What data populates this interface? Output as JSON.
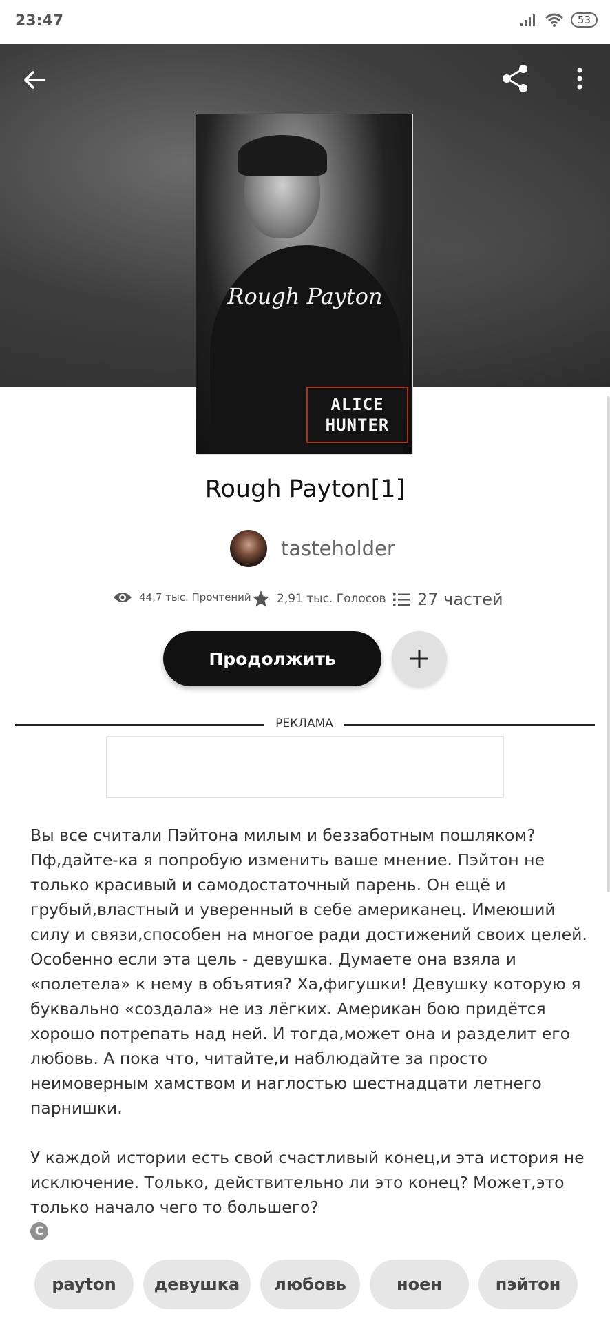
{
  "status_bar": {
    "time": "23:47",
    "battery": "53"
  },
  "toolbar": {
    "back": "back",
    "share": "share",
    "more": "more"
  },
  "cover": {
    "title": "Rough Payton",
    "stamp_line1": "ALICE",
    "stamp_line2": "HUNTER"
  },
  "book": {
    "title": "Rough Payton[1]",
    "author": "tasteholder",
    "reads": "44,7 тыс. Прочтений",
    "votes": "2,91 тыс. Голосов",
    "parts": "27 частей",
    "continue_label": "Продолжить"
  },
  "ad": {
    "label": "РЕКЛАМА"
  },
  "description": {
    "paragraph1": "Вы все считали Пэйтона милым и беззаботным пошляком? Пф,дайте-ка я попробую изменить ваше мнение. Пэйтон не только красивый и самодостаточный парень. Он ещё и грубый,властный и уверенный в себе американец. Имеюший силу и связи,способен на многое ради достижений своих целей. Особенно если эта цель - девушка. Думаете она взяла и «полетела» к нему в объятия? Ха,фигушки! Девушку которую я буквально «создала» не из лёгких. Американ бою придётся хорошо потрепать над ней. И тогда,может она и разделит его любовь. А пока что, читайте,и наблюдайте за просто неимоверным хамством и наглостью шестнадцати летнего парнишки.",
    "paragraph2": "У каждой истории есть свой счастливый конец,и эта история не исключение. Только, действительно ли это конец? Может,это только начало чего то большего?"
  },
  "copyright_symbol": "C",
  "tags": [
    "payton",
    "девушка",
    "любовь",
    "ноен",
    "пэйтон"
  ]
}
